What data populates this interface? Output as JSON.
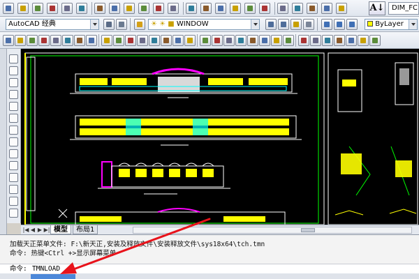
{
  "toolbar_top": {
    "brand_glyph": "A↓",
    "document_title": "DIM_FC",
    "icons": [
      "new-icon",
      "open-icon",
      "save-icon",
      "print-icon",
      "preview-icon",
      "publish-icon",
      "cut-icon",
      "copy-icon",
      "paste-icon",
      "match-properties-icon",
      "undo-icon",
      "redo-icon",
      "pan-icon",
      "zoom-realtime-icon",
      "zoom-window-icon",
      "zoom-previous-icon",
      "properties-icon",
      "design-center-icon",
      "tool-palettes-icon",
      "sheet-set-icon",
      "markup-icon",
      "quickcalc-icon",
      "help-icon"
    ]
  },
  "toolbar_layers": {
    "workspace": "AutoCAD 经典",
    "layer": "WINDOW",
    "color_control": "ByLayer"
  },
  "toolbar_draw": {
    "icons": [
      "ucs-icon",
      "line-icon",
      "ray-icon",
      "polyline-icon",
      "polygon-icon",
      "rectangle-icon",
      "arc-icon",
      "circle-icon",
      "spline-icon",
      "ellipse-icon",
      "block-icon",
      "hatch-icon",
      "region-icon",
      "table-icon",
      "text-icon",
      "erase-icon",
      "copy-object-icon",
      "mirror-icon",
      "offset-icon",
      "array-icon",
      "move-icon",
      "rotate-icon",
      "scale-icon",
      "stretch-icon",
      "trim-icon",
      "extend-icon",
      "break-icon",
      "join-icon",
      "chamfer-icon",
      "fillet-icon",
      "explode-icon"
    ]
  },
  "layout_tabs": {
    "model": "模型",
    "layout1": "布局1"
  },
  "command_history": [
    "加载天正菜单文件: F:\\新天正,安装及释放文件\\安装释放文件\\sys18x64\\tch.tmn",
    "命令: 热键<Ctrl +>显示屏幕菜单"
  ],
  "command_prompt": "命令:",
  "command_input": "TMNLOAD",
  "colors": {
    "drawing_yellow": "#ffff00",
    "drawing_magenta": "#ff00ff",
    "drawing_cyan": "#00ffff",
    "drawing_green": "#00ff00",
    "annotation_arrow": "#e8131b"
  }
}
